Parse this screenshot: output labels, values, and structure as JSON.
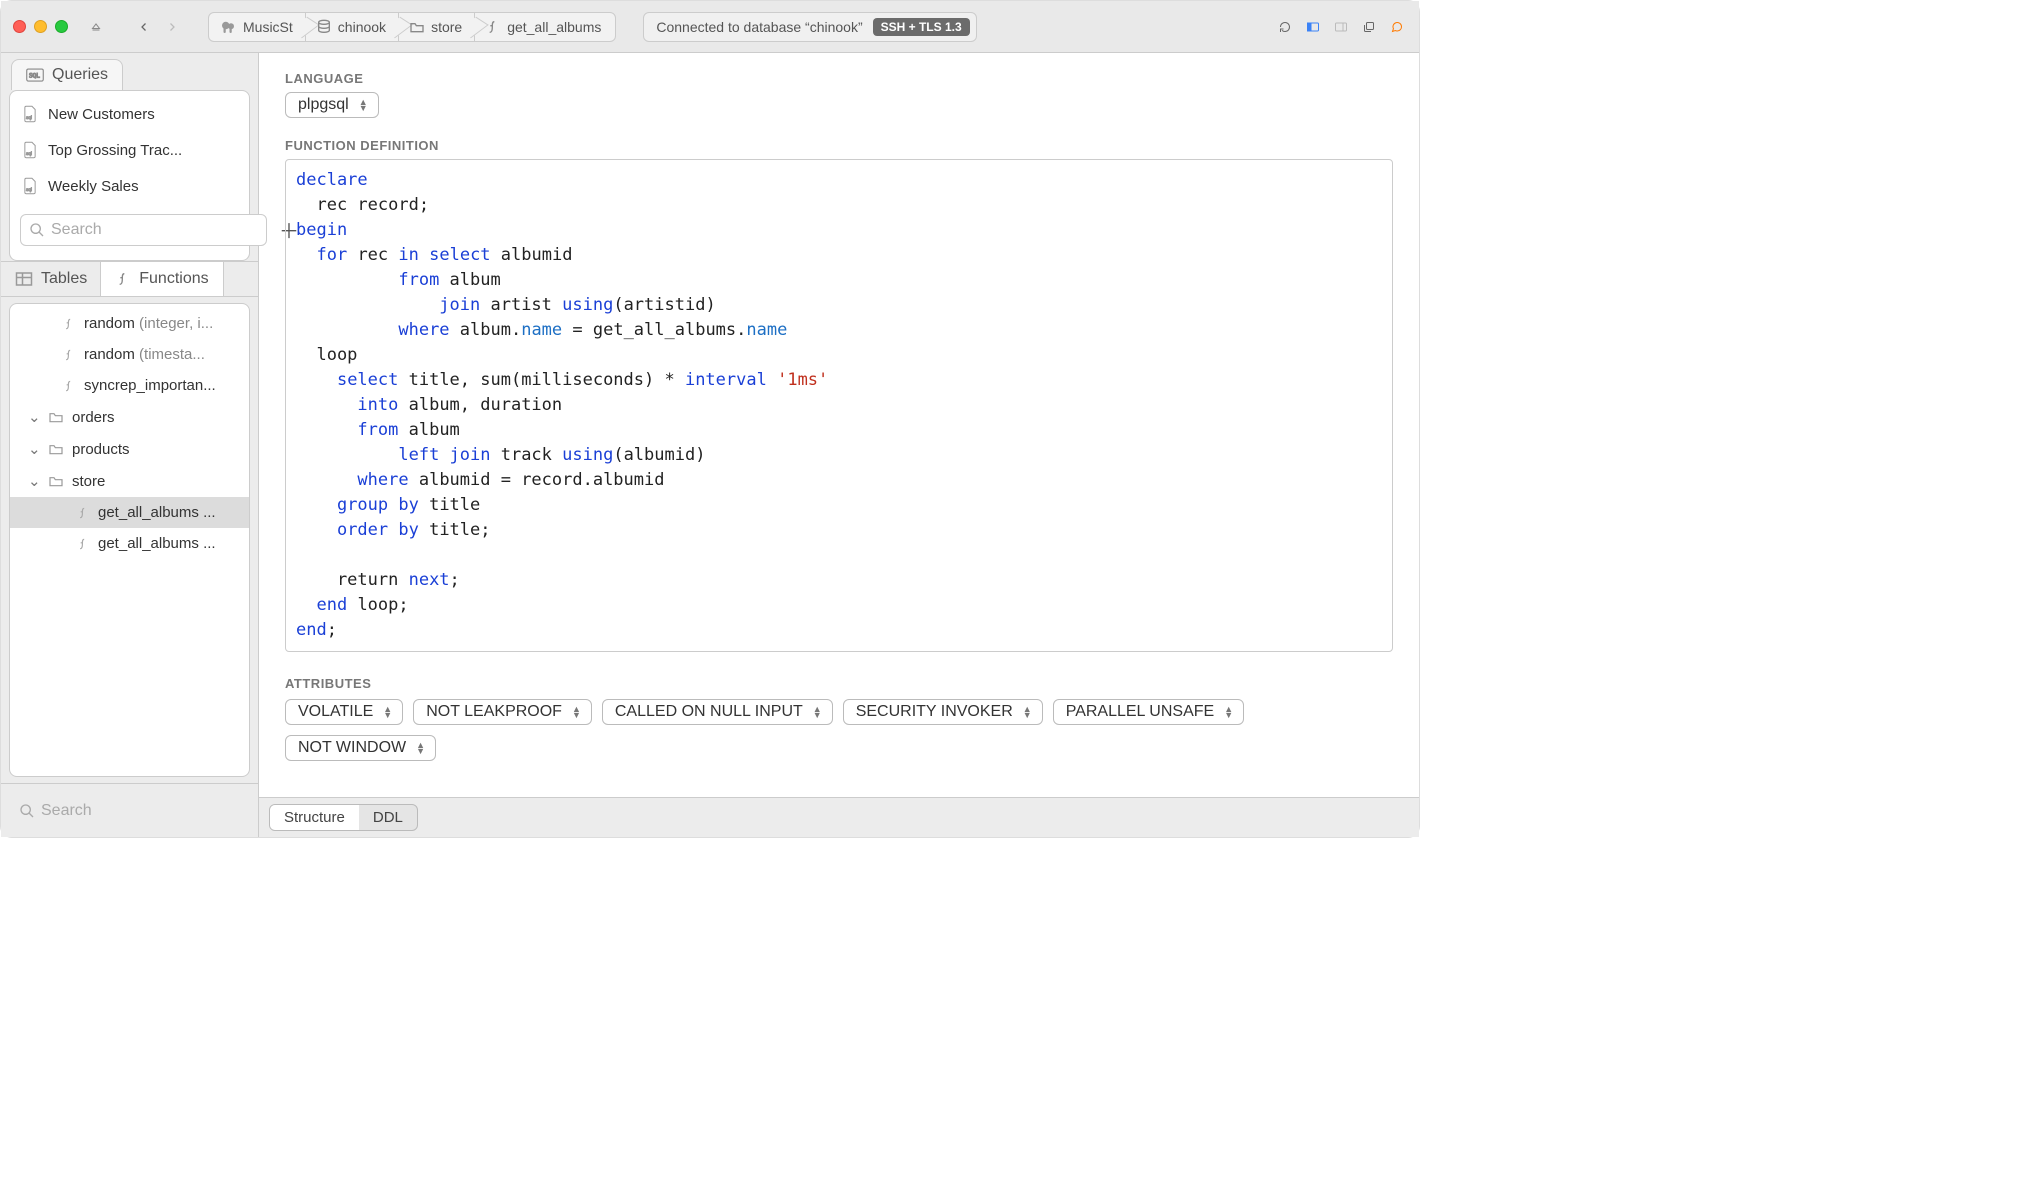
{
  "breadcrumbs": [
    "MusicSt",
    "chinook",
    "store",
    "get_all_albums"
  ],
  "status_text": "Connected to database “chinook”",
  "ssh_badge": "SSH + TLS 1.3",
  "queries_tab": "Queries",
  "queries": [
    "New Customers",
    "Top Grossing Trac...",
    "Weekly Sales"
  ],
  "search_placeholder": "Search",
  "subtabs": {
    "tables": "Tables",
    "functions": "Functions"
  },
  "tree": {
    "items": [
      {
        "type": "fn",
        "name": "random",
        "sig": "(integer, i..."
      },
      {
        "type": "fn",
        "name": "random",
        "sig": "(timesta..."
      },
      {
        "type": "fn",
        "name": "syncrep_importan...",
        "sig": ""
      },
      {
        "type": "folder",
        "name": "orders"
      },
      {
        "type": "folder",
        "name": "products"
      },
      {
        "type": "folder",
        "name": "store",
        "open": true,
        "children": [
          {
            "name": "get_all_albums ...",
            "selected": true
          },
          {
            "name": "get_all_albums ..."
          }
        ]
      }
    ]
  },
  "section": {
    "language_label": "LANGUAGE",
    "language_value": "plpgsql",
    "definition_label": "FUNCTION DEFINITION",
    "attributes_label": "ATTRIBUTES"
  },
  "attributes": [
    "VOLATILE",
    "NOT LEAKPROOF",
    "CALLED ON NULL INPUT",
    "SECURITY INVOKER",
    "PARALLEL UNSAFE",
    "NOT WINDOW"
  ],
  "footer_tabs": [
    "Structure",
    "DDL"
  ],
  "code_tokens": [
    [
      {
        "t": "declare",
        "c": "kw"
      }
    ],
    [
      {
        "t": "  rec record;",
        "c": ""
      }
    ],
    [
      {
        "t": "begin",
        "c": "kw"
      }
    ],
    [
      {
        "t": "  ",
        "c": ""
      },
      {
        "t": "for",
        "c": "kw"
      },
      {
        "t": " rec ",
        "c": ""
      },
      {
        "t": "in",
        "c": "kw"
      },
      {
        "t": " ",
        "c": ""
      },
      {
        "t": "select",
        "c": "kw"
      },
      {
        "t": " albumid",
        "c": ""
      }
    ],
    [
      {
        "t": "          ",
        "c": ""
      },
      {
        "t": "from",
        "c": "kw"
      },
      {
        "t": " album",
        "c": ""
      }
    ],
    [
      {
        "t": "              ",
        "c": ""
      },
      {
        "t": "join",
        "c": "kw"
      },
      {
        "t": " artist ",
        "c": ""
      },
      {
        "t": "using",
        "c": "kw"
      },
      {
        "t": "(artistid)",
        "c": ""
      }
    ],
    [
      {
        "t": "          ",
        "c": ""
      },
      {
        "t": "where",
        "c": "kw"
      },
      {
        "t": " album.",
        "c": ""
      },
      {
        "t": "name",
        "c": "id"
      },
      {
        "t": " = get_all_albums.",
        "c": ""
      },
      {
        "t": "name",
        "c": "id"
      }
    ],
    [
      {
        "t": "  loop",
        "c": ""
      }
    ],
    [
      {
        "t": "    ",
        "c": ""
      },
      {
        "t": "select",
        "c": "kw"
      },
      {
        "t": " title, ",
        "c": ""
      },
      {
        "t": "sum",
        "c": ""
      },
      {
        "t": "(milliseconds) * ",
        "c": ""
      },
      {
        "t": "interval",
        "c": "kw"
      },
      {
        "t": " ",
        "c": ""
      },
      {
        "t": "'1ms'",
        "c": "str"
      }
    ],
    [
      {
        "t": "      ",
        "c": ""
      },
      {
        "t": "into",
        "c": "kw"
      },
      {
        "t": " album, duration",
        "c": ""
      }
    ],
    [
      {
        "t": "      ",
        "c": ""
      },
      {
        "t": "from",
        "c": "kw"
      },
      {
        "t": " album",
        "c": ""
      }
    ],
    [
      {
        "t": "          ",
        "c": ""
      },
      {
        "t": "left join",
        "c": "kw"
      },
      {
        "t": " track ",
        "c": ""
      },
      {
        "t": "using",
        "c": "kw"
      },
      {
        "t": "(albumid)",
        "c": ""
      }
    ],
    [
      {
        "t": "      ",
        "c": ""
      },
      {
        "t": "where",
        "c": "kw"
      },
      {
        "t": " albumid = record.albumid",
        "c": ""
      }
    ],
    [
      {
        "t": "    ",
        "c": ""
      },
      {
        "t": "group by",
        "c": "kw"
      },
      {
        "t": " title",
        "c": ""
      }
    ],
    [
      {
        "t": "    ",
        "c": ""
      },
      {
        "t": "order by",
        "c": "kw"
      },
      {
        "t": " title;",
        "c": ""
      }
    ],
    [
      {
        "t": "",
        "c": ""
      }
    ],
    [
      {
        "t": "    return ",
        "c": ""
      },
      {
        "t": "next",
        "c": "kw"
      },
      {
        "t": ";",
        "c": ""
      }
    ],
    [
      {
        "t": "  ",
        "c": ""
      },
      {
        "t": "end",
        "c": "kw"
      },
      {
        "t": " loop;",
        "c": ""
      }
    ],
    [
      {
        "t": "end",
        "c": "kw"
      },
      {
        "t": ";",
        "c": ""
      }
    ]
  ]
}
